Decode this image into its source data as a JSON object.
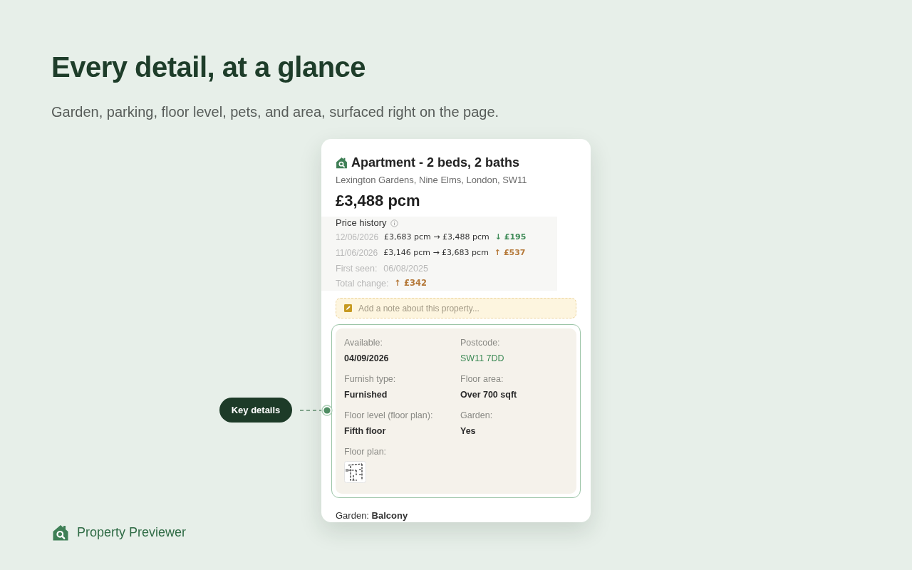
{
  "headline": "Every detail, at a glance",
  "subheadline": "Garden, parking, floor level, pets, and area, surfaced right on the page.",
  "listing_card": {
    "title": "Apartment - 2 beds, 2 baths",
    "address": "Lexington Gardens, Nine Elms, London, SW11",
    "price": "£3,488 pcm",
    "price_history": {
      "title": "Price history",
      "changes": [
        {
          "date": "12/06/2026",
          "from_to": "£3,683 pcm → £3,488 pcm",
          "change": "↓ £195",
          "increase": false
        },
        {
          "date": "11/06/2026",
          "from_to": "£3,146 pcm → £3,683 pcm",
          "change": "↑ £537",
          "increase": true
        }
      ],
      "first_seen": {
        "label": "First seen:",
        "value": "06/08/2025"
      },
      "total_change": {
        "label": "Total change:",
        "value": "↑ £342",
        "increase": true
      }
    },
    "note_field": {
      "placeholder": "Add a note about this property..."
    },
    "key_details": [
      {
        "label": "Available:",
        "value": "04/09/2026",
        "kind": "text"
      },
      {
        "label": "Postcode:",
        "value": "SW11 7DD",
        "kind": "link"
      },
      {
        "label": "Furnish type:",
        "value": "Furnished",
        "kind": "text"
      },
      {
        "label": "Floor area:",
        "value": "Over 700 sqft",
        "kind": "text"
      },
      {
        "label": "Floor level (floor plan):",
        "value": "Fifth floor",
        "kind": "text"
      },
      {
        "label": "Garden:",
        "value": "Yes",
        "kind": "text"
      },
      {
        "label": "Floor plan:",
        "kind": "image"
      }
    ],
    "garden_summary": "Garden: **Balcony**"
  },
  "callout": {
    "label": "Key details"
  },
  "brand": {
    "name": "Property Previewer"
  }
}
